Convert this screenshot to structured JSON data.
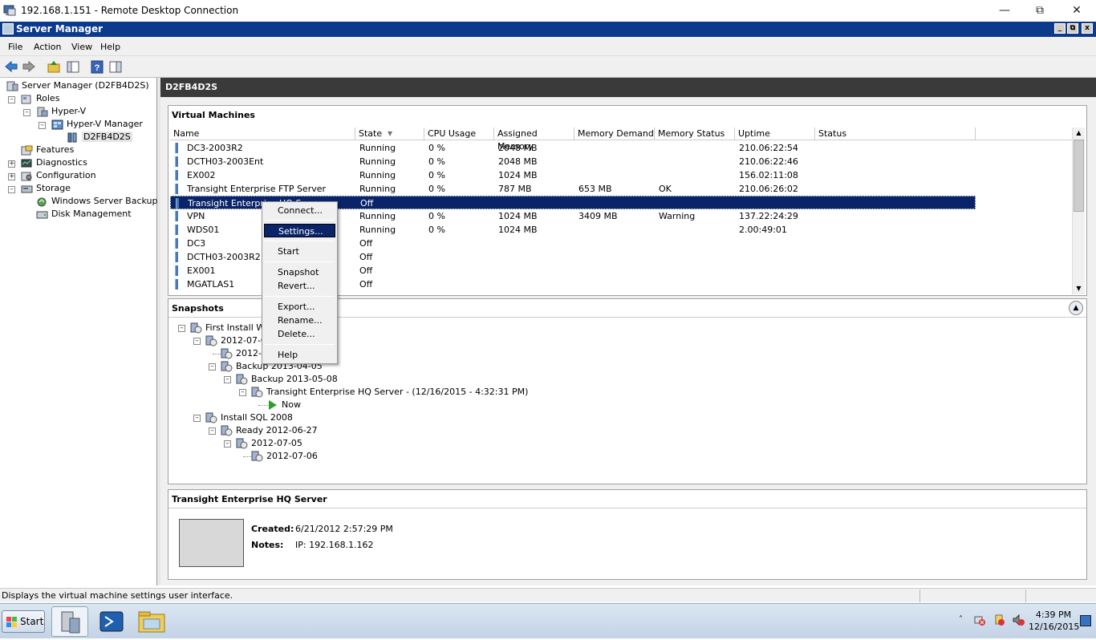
{
  "rdp": {
    "title": "192.168.1.151 - Remote Desktop Connection"
  },
  "app": {
    "title": "Server Manager"
  },
  "menu": [
    "File",
    "Action",
    "View",
    "Help"
  ],
  "tree": {
    "root": "Server Manager (D2FB4D2S)",
    "roles": "Roles",
    "hyperv": "Hyper-V",
    "hyperv_manager": "Hyper-V Manager",
    "host": "D2FB4D2S",
    "features": "Features",
    "diagnostics": "Diagnostics",
    "configuration": "Configuration",
    "storage": "Storage",
    "backup": "Windows Server Backup",
    "disk": "Disk Management"
  },
  "main": {
    "header": "D2FB4D2S"
  },
  "vm_panel": {
    "title": "Virtual Machines",
    "columns": [
      "Name",
      "State",
      "CPU Usage",
      "Assigned Memory",
      "Memory Demand",
      "Memory Status",
      "Uptime",
      "Status"
    ],
    "rows": [
      {
        "name": "DC3-2003R2",
        "state": "Running",
        "cpu": "0 %",
        "assigned": "2048 MB",
        "demand": "",
        "mstatus": "",
        "uptime": "210.06:22:54",
        "status": ""
      },
      {
        "name": "DCTH03-2003Ent",
        "state": "Running",
        "cpu": "0 %",
        "assigned": "2048 MB",
        "demand": "",
        "mstatus": "",
        "uptime": "210.06:22:46",
        "status": ""
      },
      {
        "name": "EX002",
        "state": "Running",
        "cpu": "0 %",
        "assigned": "1024 MB",
        "demand": "",
        "mstatus": "",
        "uptime": "156.02:11:08",
        "status": ""
      },
      {
        "name": "Transight Enterprise FTP Server",
        "state": "Running",
        "cpu": "0 %",
        "assigned": "787 MB",
        "demand": "653 MB",
        "mstatus": "OK",
        "uptime": "210.06:26:02",
        "status": ""
      },
      {
        "name": "Transight Enterprise HQ Server",
        "state": "Off",
        "cpu": "",
        "assigned": "",
        "demand": "",
        "mstatus": "",
        "uptime": "",
        "status": ""
      },
      {
        "name": "VPN",
        "state": "Running",
        "cpu": "0 %",
        "assigned": "1024 MB",
        "demand": "3409 MB",
        "mstatus": "Warning",
        "uptime": "137.22:24:29",
        "status": ""
      },
      {
        "name": "WDS01",
        "state": "Running",
        "cpu": "0 %",
        "assigned": "1024 MB",
        "demand": "",
        "mstatus": "",
        "uptime": "2.00:49:01",
        "status": ""
      },
      {
        "name": "DC3",
        "state": "Off",
        "cpu": "",
        "assigned": "",
        "demand": "",
        "mstatus": "",
        "uptime": "",
        "status": ""
      },
      {
        "name": "DCTH03-2003R2",
        "state": "Off",
        "cpu": "",
        "assigned": "",
        "demand": "",
        "mstatus": "",
        "uptime": "",
        "status": ""
      },
      {
        "name": "EX001",
        "state": "Off",
        "cpu": "",
        "assigned": "",
        "demand": "",
        "mstatus": "",
        "uptime": "",
        "status": ""
      },
      {
        "name": "MGATLAS1",
        "state": "Off",
        "cpu": "",
        "assigned": "",
        "demand": "",
        "mstatus": "",
        "uptime": "",
        "status": ""
      }
    ],
    "selected_index": 4
  },
  "context_menu": {
    "items": [
      "Connect...",
      "Settings...",
      "Start",
      "Snapshot",
      "Revert...",
      "Export...",
      "Rename...",
      "Delete...",
      "Help"
    ],
    "highlighted": "Settings..."
  },
  "snapshots": {
    "title": "Snapshots",
    "nodes": [
      {
        "label": "First Install Wir",
        "depth": 0
      },
      {
        "label": "2012-07-0",
        "depth": 1
      },
      {
        "label": "2012-0",
        "depth": 2
      },
      {
        "label": "Backup 2013-04-05",
        "depth": 2
      },
      {
        "label": "Backup 2013-05-08",
        "depth": 3
      },
      {
        "label": "Transight Enterprise HQ Server - (12/16/2015 - 4:32:31 PM)",
        "depth": 4
      },
      {
        "label": "Now",
        "depth": 5
      },
      {
        "label": "Install SQL 2008",
        "depth": 1
      },
      {
        "label": "Ready 2012-06-27",
        "depth": 2
      },
      {
        "label": "2012-07-05",
        "depth": 3
      },
      {
        "label": "2012-07-06",
        "depth": 4
      }
    ]
  },
  "details": {
    "title": "Transight Enterprise HQ Server",
    "created_label": "Created:",
    "created_value": "6/21/2012 2:57:29 PM",
    "notes_label": "Notes:",
    "notes_value": "IP: 192.168.1.162"
  },
  "status": {
    "text": "Displays the virtual machine settings user interface."
  },
  "taskbar": {
    "start": "Start",
    "time": "4:39 PM",
    "date": "12/16/2015"
  },
  "colors": {
    "title_bar": "#0c3a8c",
    "selection": "#0a246a",
    "header_dark": "#3a3a3a"
  }
}
